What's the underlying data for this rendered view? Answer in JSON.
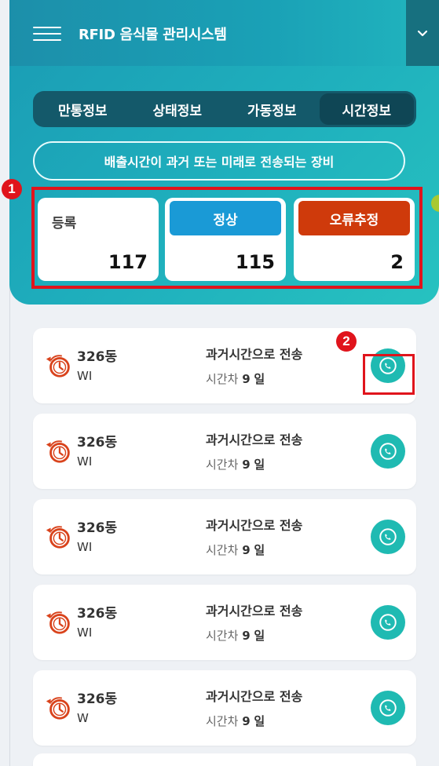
{
  "header": {
    "title": "RFID 음식물 관리시스템"
  },
  "tabs": [
    {
      "label": "만통정보",
      "active": false
    },
    {
      "label": "상태정보",
      "active": false
    },
    {
      "label": "가동정보",
      "active": false
    },
    {
      "label": "시간정보",
      "active": true
    }
  ],
  "description": "배출시간이 과거 또는 미래로 전송되는 장비",
  "stats": {
    "registered": {
      "label": "등록",
      "count": "117"
    },
    "normal": {
      "label": "정상",
      "count": "115",
      "color": "#1a9ad6"
    },
    "error": {
      "label": "오류추정",
      "count": "2",
      "color": "#cf3a0b"
    }
  },
  "markers": [
    "1",
    "2"
  ],
  "list": [
    {
      "building": "326동",
      "sub": "WI",
      "status": "과거시간으로 전송",
      "diff_label": "시간차",
      "diff_value": "9",
      "diff_unit": "일"
    },
    {
      "building": "326동",
      "sub": "WI",
      "status": "과거시간으로 전송",
      "diff_label": "시간차",
      "diff_value": "9",
      "diff_unit": "일"
    },
    {
      "building": "326동",
      "sub": "WI",
      "status": "과거시간으로 전송",
      "diff_label": "시간차",
      "diff_value": "9",
      "diff_unit": "일"
    },
    {
      "building": "326동",
      "sub": "WI",
      "status": "과거시간으로 전송",
      "diff_label": "시간차",
      "diff_value": "9",
      "diff_unit": "일"
    },
    {
      "building": "326동",
      "sub": "W",
      "status": "과거시간으로 전송",
      "diff_label": "시간차",
      "diff_value": "9",
      "diff_unit": "일"
    }
  ],
  "colors": {
    "accent": "#1fbab2",
    "alert_red": "#e0141c",
    "clock_icon": "#d9431c"
  },
  "icons": {
    "menu": "hamburger-menu-icon",
    "dropdown": "chevron-down-icon",
    "item": "clock-rewind-icon",
    "action": "phone-icon"
  }
}
